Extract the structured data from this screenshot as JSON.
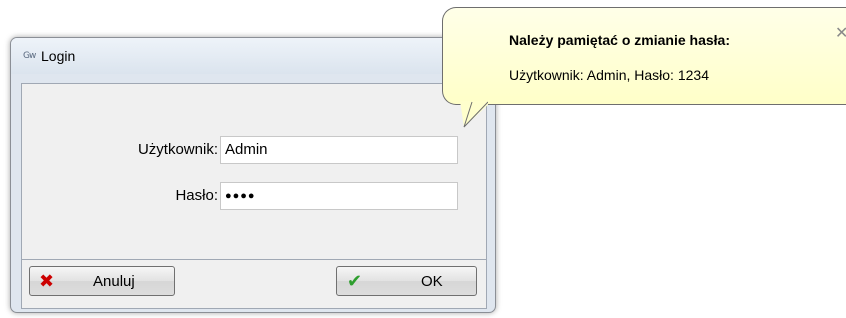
{
  "window": {
    "title": "Login",
    "app_icon": "Gw"
  },
  "form": {
    "user_label": "Użytkownik:",
    "user_value": "Admin",
    "password_label": "Hasło:",
    "password_value": "●●●●"
  },
  "buttons": {
    "cancel_label": "Anuluj",
    "cancel_icon": "✖",
    "ok_label": "OK",
    "ok_icon": "✔"
  },
  "balloon": {
    "title": "Należy pamiętać o zmianie hasła:",
    "text": "Użytkownik: Admin, Hasło: 1234",
    "close_icon": "✕"
  },
  "colors": {
    "cancel_icon": "#cc0000",
    "ok_icon": "#2e9e2e",
    "balloon_bg": "#ffffd8"
  }
}
